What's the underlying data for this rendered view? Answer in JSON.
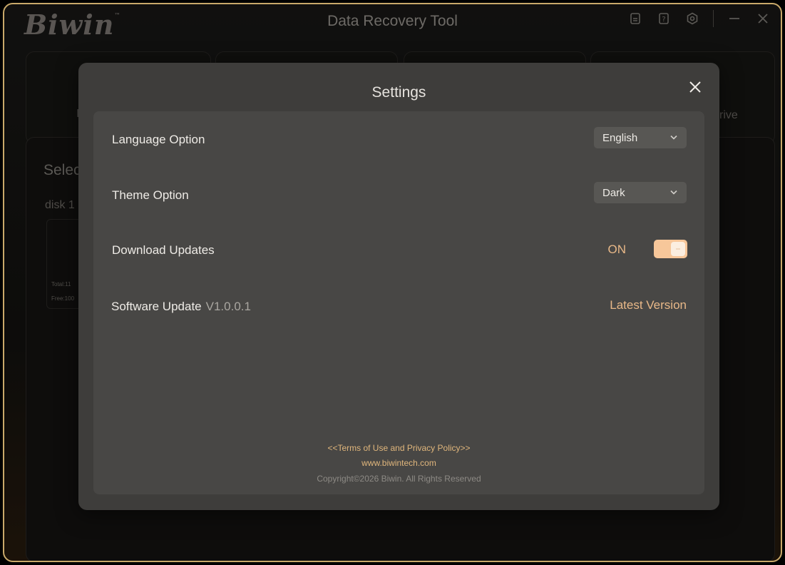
{
  "app": {
    "logo": "Biwin",
    "logo_tm": "™",
    "title": "Data Recovery Tool"
  },
  "title_controls": {
    "icons": [
      "document-icon",
      "help-icon",
      "settings-hex-icon",
      "minimize-icon",
      "close-icon"
    ]
  },
  "background": {
    "card_label_partial_1": "I",
    "card_label_partial_4": "rive",
    "section_title_partial": "Selec",
    "disk_label_partial": "disk 1",
    "total_partial": "Total:11",
    "free_partial": "Free:100"
  },
  "settings": {
    "title": "Settings",
    "language_label": "Language Option",
    "language_value": "English",
    "theme_label": "Theme Option",
    "theme_value": "Dark",
    "download_label": "Download Updates",
    "download_state": "ON",
    "download_enabled": true,
    "update_label": "Software Update",
    "update_version": "V1.0.0.1",
    "update_status": "Latest Version"
  },
  "footer": {
    "terms_link": "<<Terms of Use and Privacy Policy>>",
    "website": "www.biwintech.com",
    "copyright": "Copyright©2026 Biwin. All Rights Reserved"
  },
  "colors": {
    "accent": "#e8b888",
    "toggle_on": "#f7c79a",
    "frame_border": "#c9a96a",
    "modal_bg": "#3e3d3b",
    "panel_bg": "#484745"
  }
}
